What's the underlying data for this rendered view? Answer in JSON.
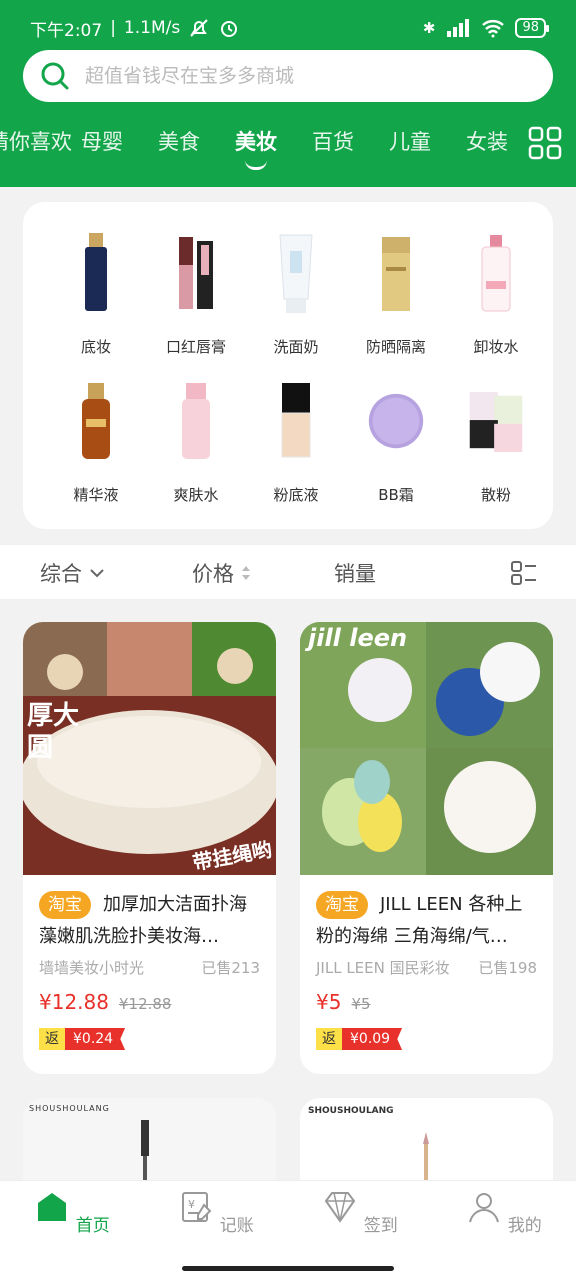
{
  "status": {
    "time": "下午2:07",
    "speed": "1.1M/s",
    "battery": "98"
  },
  "search": {
    "placeholder": "超值省钱尽在宝多多商城"
  },
  "tabs": [
    {
      "label": "猜你喜欢"
    },
    {
      "label": "母婴"
    },
    {
      "label": "美食"
    },
    {
      "label": "美妆"
    },
    {
      "label": "百货"
    },
    {
      "label": "儿童"
    },
    {
      "label": "女装"
    }
  ],
  "categories": [
    {
      "label": "底妆",
      "icon": "foundation-bottle-icon"
    },
    {
      "label": "口红唇膏",
      "icon": "lipstick-icon"
    },
    {
      "label": "洗面奶",
      "icon": "cleanser-tube-icon"
    },
    {
      "label": "防晒隔离",
      "icon": "sunscreen-bottle-icon"
    },
    {
      "label": "卸妆水",
      "icon": "makeup-remover-bottle-icon"
    },
    {
      "label": "精华液",
      "icon": "serum-bottle-icon"
    },
    {
      "label": "爽肤水",
      "icon": "toner-bottle-icon"
    },
    {
      "label": "粉底液",
      "icon": "liquid-foundation-icon"
    },
    {
      "label": "BB霜",
      "icon": "bb-cream-compact-icon"
    },
    {
      "label": "散粉",
      "icon": "loose-powder-icon"
    }
  ],
  "sort": {
    "comprehensive": "综合",
    "price": "价格",
    "sales": "销量"
  },
  "products": [
    {
      "image_text_1": "厚大圆",
      "image_text_2": "带挂绳哟",
      "source": "淘宝",
      "title": "加厚加大洁面扑海藻嫩肌洗脸扑美妆海…",
      "shop": "墙墙美妆小时光",
      "sold": "已售213",
      "price": "¥12.88",
      "old_price": "¥12.88",
      "rebate_label": "返",
      "rebate": "¥0.24"
    },
    {
      "image_text_1": "jill leen",
      "source": "淘宝",
      "title": "JILL LEEN 各种上粉的海绵 三角海绵/气…",
      "shop": "JILL LEEN 国民彩妆",
      "sold": "已售198",
      "price": "¥5",
      "old_price": "¥5",
      "rebate_label": "返",
      "rebate": "¥0.09"
    }
  ],
  "partial_products": [
    {
      "brand": "SHOUSHOULANG"
    },
    {
      "brand": "SHOUSHOULANG"
    }
  ],
  "nav": [
    {
      "label": "首页"
    },
    {
      "label": "记账"
    },
    {
      "label": "签到"
    },
    {
      "label": "我的"
    }
  ],
  "colors": {
    "brand": "#12a54a",
    "price": "#e8312a",
    "tag": "#f5a623"
  }
}
